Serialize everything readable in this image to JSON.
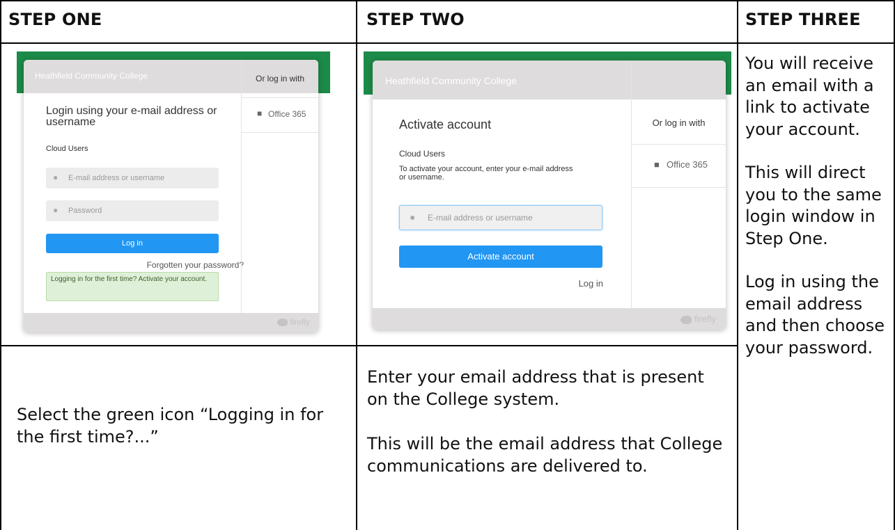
{
  "headers": [
    "STEP ONE",
    "STEP TWO",
    "STEP THREE"
  ],
  "step_one": {
    "college_name": "Heathfield Community College",
    "title": "Login using your e-mail address or username",
    "cloud_users": "Cloud Users",
    "email_placeholder": "E-mail address or username",
    "password_placeholder": "Password",
    "login_button": "Log in",
    "forgot_link": "Forgotten your password?",
    "first_time_notice": "Logging in for the first time? Activate your account.",
    "or_log_in_with": "Or log in with",
    "office_label": "Office 365",
    "brand": "firefly",
    "instruction": "Select the green icon “Logging in for the first time?...”"
  },
  "step_two": {
    "college_name": "Heathfield Community College",
    "title": "Activate account",
    "cloud_users": "Cloud Users",
    "description": "To activate your account, enter your e-mail address or username.",
    "email_placeholder": "E-mail address or username",
    "activate_button": "Activate account",
    "login_link": "Log in",
    "or_log_in_with": "Or log in with",
    "office_label": "Office 365",
    "brand": "firefly",
    "instruction_1": "Enter your email address that is present on the College system.",
    "instruction_2": "This will be the email address that College communications are delivered to."
  },
  "step_three": {
    "para_1": "You will receive an email with a link to activate your account.",
    "para_2": "This will direct you to the same login window in Step One.",
    "para_3": "Log in using the email address and then choose your password."
  },
  "colors": {
    "green_bar": "#1c8a48",
    "button_blue": "#2196f3",
    "notice_bg": "#dff0d8",
    "notice_border": "#b9dca6"
  }
}
